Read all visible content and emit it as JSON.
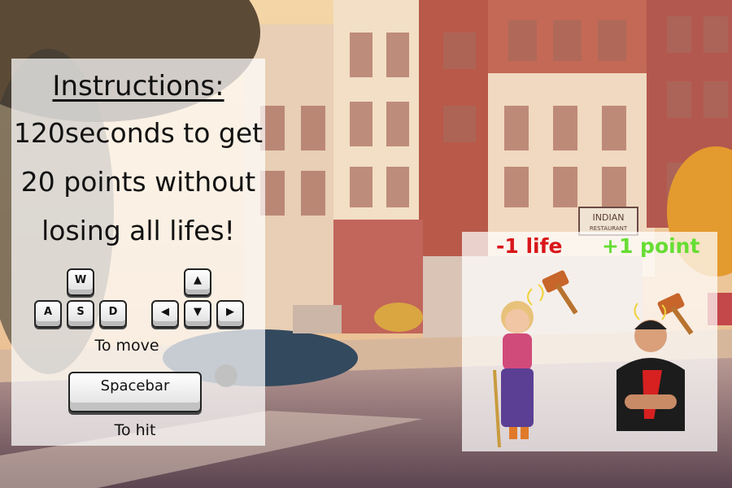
{
  "instructions": {
    "title": "Instructions:",
    "line1": "120seconds to get",
    "line2": "20 points without",
    "line3": "losing all lifes!",
    "keys": {
      "w": "W",
      "a": "A",
      "s": "S",
      "d": "D",
      "up": "▲",
      "left": "◀",
      "down": "▼",
      "right": "▶",
      "spacebar": "Spacebar"
    },
    "move_caption": "To move",
    "hit_caption": "To hit"
  },
  "legend": {
    "penalty_label": "-1 life",
    "reward_label": "+1 point",
    "penalty_color": "#d8161a",
    "reward_color": "#66dd33"
  },
  "sign": {
    "line1": "INDIAN",
    "line2": "RESTAURANT"
  }
}
